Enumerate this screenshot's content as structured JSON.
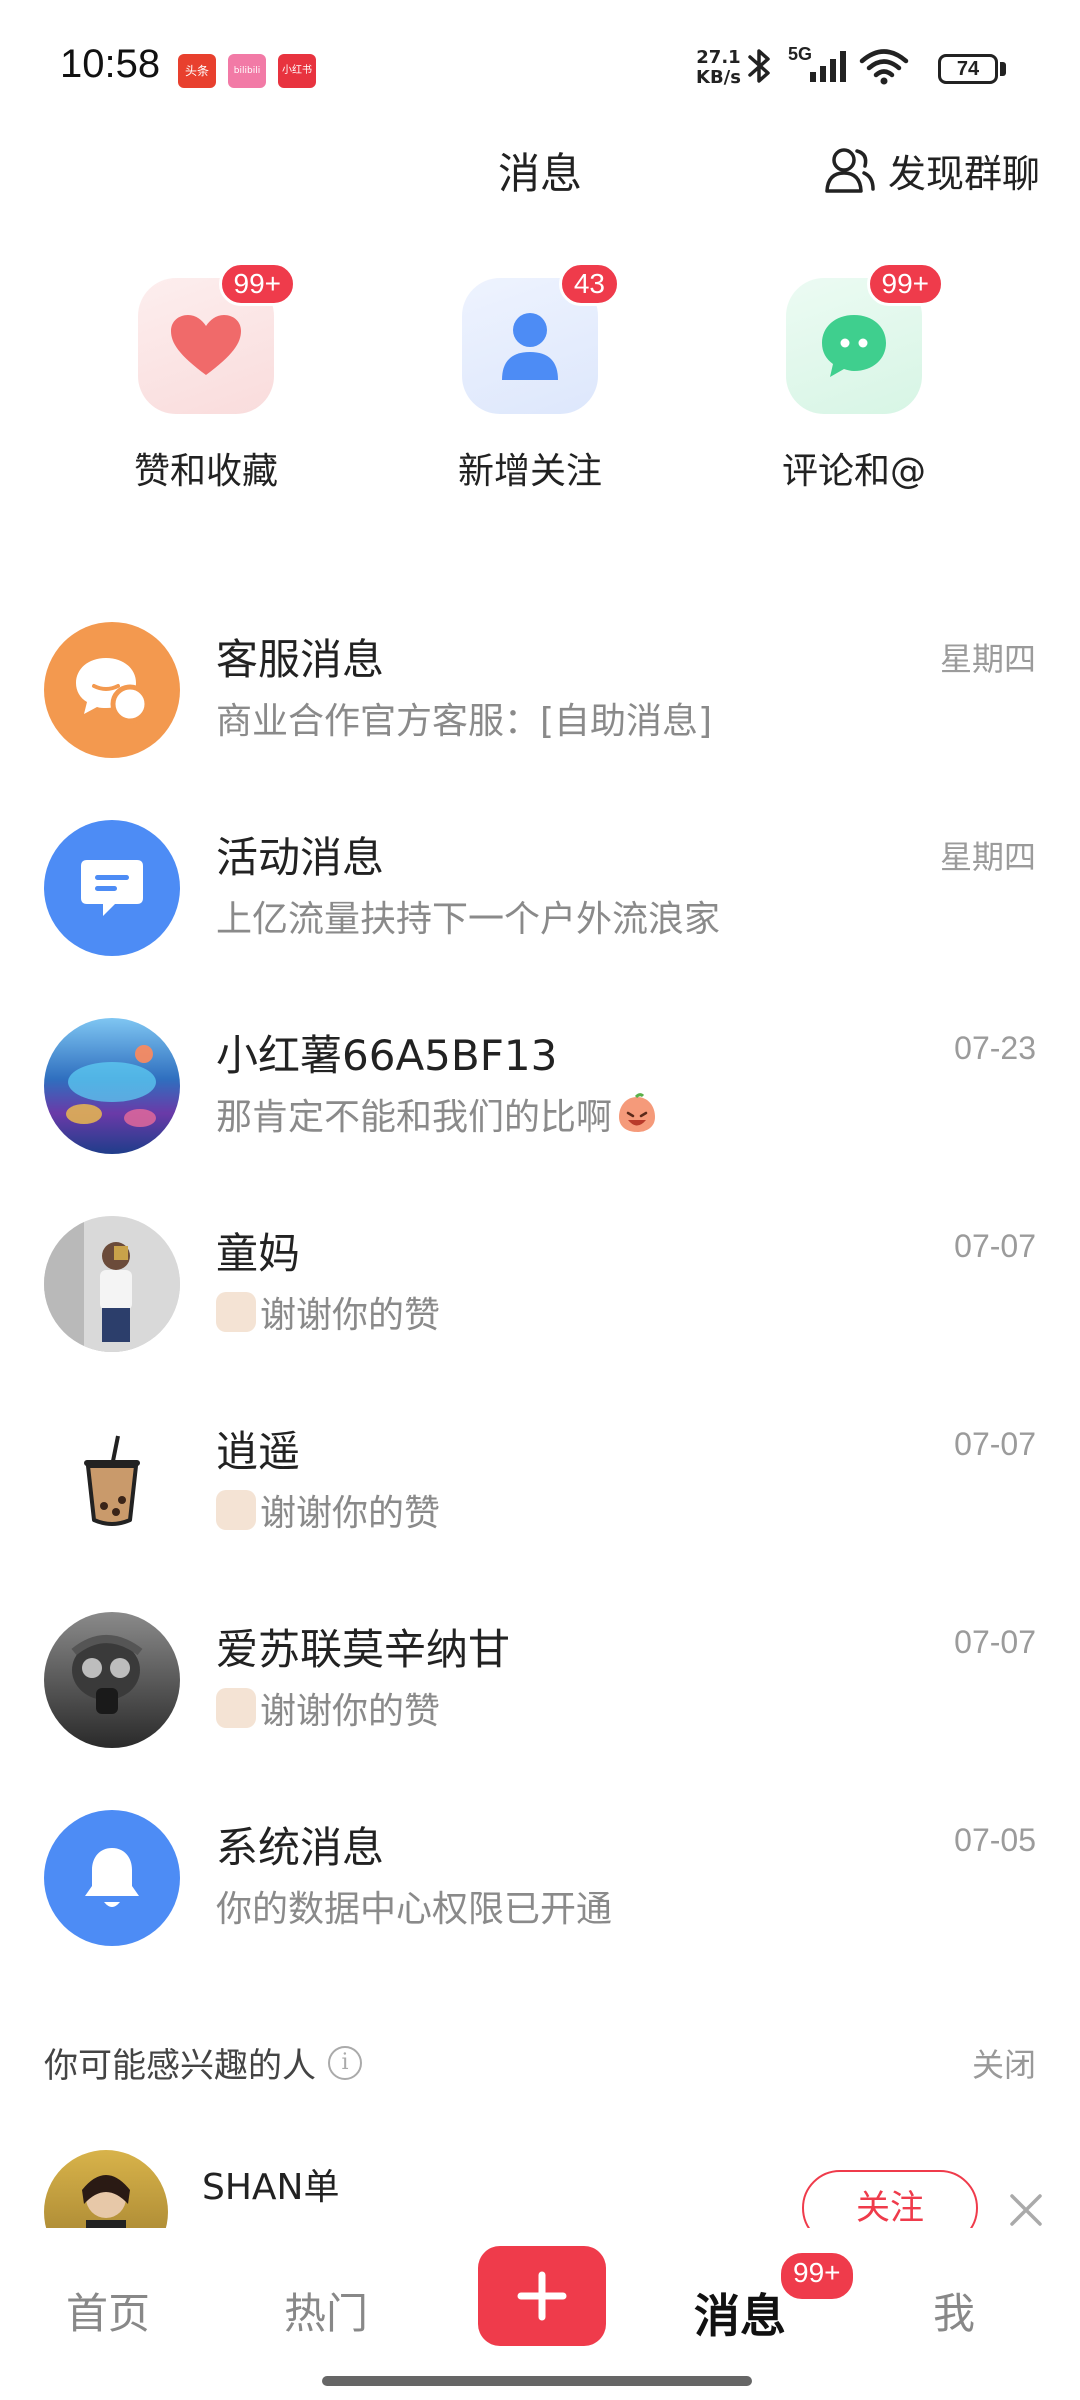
{
  "status_bar": {
    "time": "10:58",
    "notification_apps": [
      "头条",
      "bilibili",
      "小红书"
    ],
    "net_speed_value": "27.1",
    "net_speed_unit": "KB/s",
    "network_type": "5G",
    "battery": "74"
  },
  "header": {
    "title": "消息",
    "discover_group_label": "发现群聊"
  },
  "categories": [
    {
      "label": "赞和收藏",
      "badge": "99+",
      "icon": "heart-icon",
      "color": "#f06a6a"
    },
    {
      "label": "新增关注",
      "badge": "43",
      "icon": "person-icon",
      "color": "#4d8cf5"
    },
    {
      "label": "评论和@",
      "badge": "99+",
      "icon": "chat-bubble-icon",
      "color": "#3fcf8e"
    }
  ],
  "messages": [
    {
      "name": "客服消息",
      "preview": "商业合作官方客服：[自助消息]",
      "time": "星期四",
      "avatar": "customer-service-icon"
    },
    {
      "name": "活动消息",
      "preview": "上亿流量扶持下一个户外流浪家",
      "time": "星期四",
      "avatar": "activity-icon"
    },
    {
      "name": "小红薯66A5BF13",
      "preview": "那肯定不能和我们的比啊",
      "time": "07-23",
      "avatar": "user-avatar-aquarium"
    },
    {
      "name": "童妈",
      "preview": "谢谢你的赞",
      "time": "07-07",
      "avatar": "user-avatar-photo"
    },
    {
      "name": "逍遥",
      "preview": "谢谢你的赞",
      "time": "07-07",
      "avatar": "bubble-tea-avatar"
    },
    {
      "name": "爱苏联莫辛纳甘",
      "preview": "谢谢你的赞",
      "time": "07-07",
      "avatar": "gas-mask-avatar"
    },
    {
      "name": "系统消息",
      "preview": "你的数据中心权限已开通",
      "time": "07-05",
      "avatar": "bell-icon"
    }
  ],
  "interested": {
    "title": "你可能感兴趣的人",
    "close_label": "关闭",
    "suggestion": {
      "name": "SHAN单",
      "follow_label": "关注"
    }
  },
  "bottom_nav": {
    "items": [
      "首页",
      "热门",
      "消息",
      "我"
    ],
    "active": "消息",
    "message_badge": "99+"
  },
  "colors": {
    "accent": "#ef3b4b",
    "muted_text": "#8a8a8a"
  }
}
